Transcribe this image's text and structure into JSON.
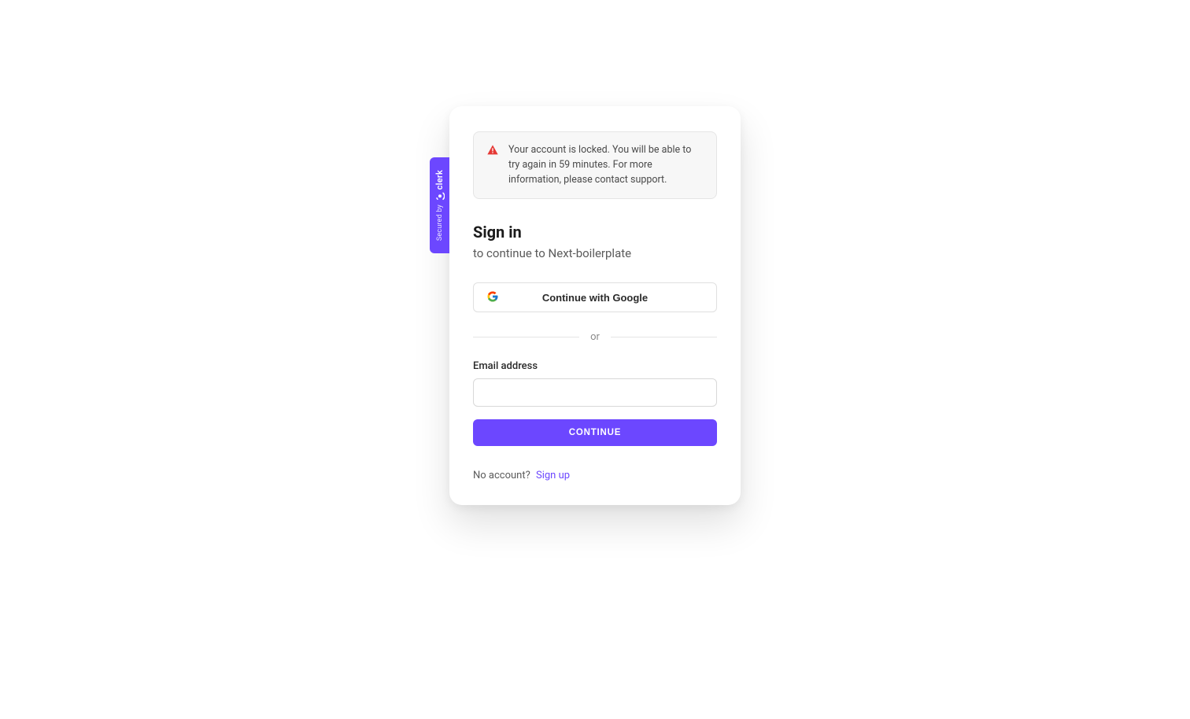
{
  "secured_tab": {
    "secured_by": "Secured by",
    "brand": "clerk"
  },
  "alert": {
    "message": "Your account is locked. You will be able to try again in 59 minutes. For more information, please contact support."
  },
  "header": {
    "title": "Sign in",
    "subtitle": "to continue to Next-boilerplate"
  },
  "oauth": {
    "google_label": "Continue with Google"
  },
  "divider": {
    "text": "or"
  },
  "form": {
    "email_label": "Email address",
    "email_value": "",
    "continue_label": "CONTINUE"
  },
  "footer": {
    "no_account": "No account?",
    "signup_label": "Sign up"
  },
  "colors": {
    "accent": "#6c47ff"
  }
}
